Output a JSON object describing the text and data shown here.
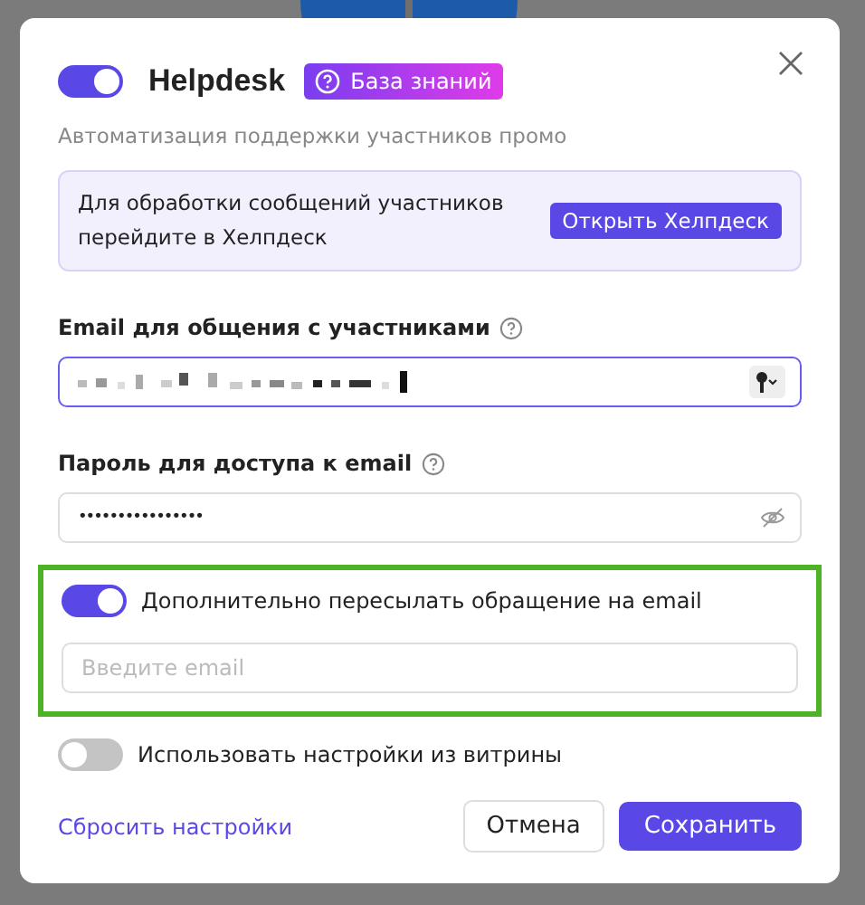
{
  "dialog": {
    "enabled": true,
    "title": "Helpdesk",
    "badge": "База знаний",
    "subtitle": "Автоматизация поддержки участников промо"
  },
  "notice": {
    "text": "Для обработки сообщений участников перейдите в Хелпдеск",
    "button": "Открыть Хелпдеск"
  },
  "email_field": {
    "label": "Email для общения с участниками",
    "focused": true
  },
  "password_field": {
    "label": "Пароль для доступа к email",
    "value": "••••••••••••••••"
  },
  "forward": {
    "label": "Дополнительно пересылать обращение на email",
    "on": true,
    "placeholder": "Введите email",
    "highlighted": true
  },
  "showcase": {
    "label": "Использовать настройки из витрины",
    "on": false
  },
  "footer": {
    "reset": "Сбросить настройки",
    "cancel": "Отмена",
    "save": "Сохранить"
  }
}
